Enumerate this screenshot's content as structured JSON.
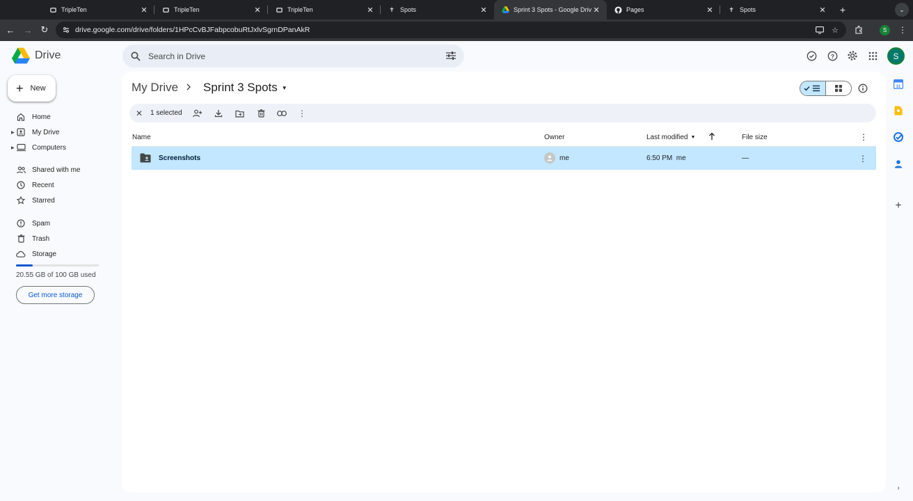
{
  "browser": {
    "tabs": [
      {
        "title": "TripleTen",
        "icon": "tripleten-icon"
      },
      {
        "title": "TripleTen",
        "icon": "tripleten-icon"
      },
      {
        "title": "TripleTen",
        "icon": "tripleten-icon"
      },
      {
        "title": "Spots",
        "icon": "spots-icon"
      },
      {
        "title": "Sprint 3 Spots - Google Drive",
        "icon": "drive-icon",
        "active": true
      },
      {
        "title": "Pages",
        "icon": "github-icon"
      },
      {
        "title": "Spots",
        "icon": "spots-icon"
      }
    ],
    "url": "drive.google.com/drive/folders/1HPcCvBJFabpcobuRtJxlvSgrnDPanAkR",
    "profile_initial": "S"
  },
  "drive": {
    "app_name": "Drive",
    "search_placeholder": "Search in Drive",
    "avatar_initial": "S",
    "new_label": "New",
    "nav": [
      {
        "label": "Home",
        "icon": "home-icon"
      },
      {
        "label": "My Drive",
        "icon": "my-drive-icon",
        "expandable": true
      },
      {
        "label": "Computers",
        "icon": "computer-icon",
        "expandable": true
      },
      {
        "label": "Shared with me",
        "icon": "shared-icon"
      },
      {
        "label": "Recent",
        "icon": "clock-icon"
      },
      {
        "label": "Starred",
        "icon": "star-icon"
      },
      {
        "label": "Spam",
        "icon": "spam-icon"
      },
      {
        "label": "Trash",
        "icon": "trash-icon"
      },
      {
        "label": "Storage",
        "icon": "cloud-icon"
      }
    ],
    "storage": {
      "text": "20.55 GB of 100 GB used",
      "fraction": 0.2055,
      "button": "Get more storage"
    },
    "breadcrumb": {
      "parent": "My Drive",
      "current": "Sprint 3 Spots"
    },
    "selection": {
      "text": "1 selected"
    },
    "columns": {
      "name": "Name",
      "owner": "Owner",
      "modified": "Last modified",
      "size": "File size"
    },
    "rows": [
      {
        "name": "Screenshots",
        "owner": "me",
        "modified": "6:50 PM  me",
        "size": "—"
      }
    ]
  },
  "colors": {
    "accent": "#0b57d0",
    "selected_row": "#c2e7ff",
    "surface": "#f8fafd"
  }
}
